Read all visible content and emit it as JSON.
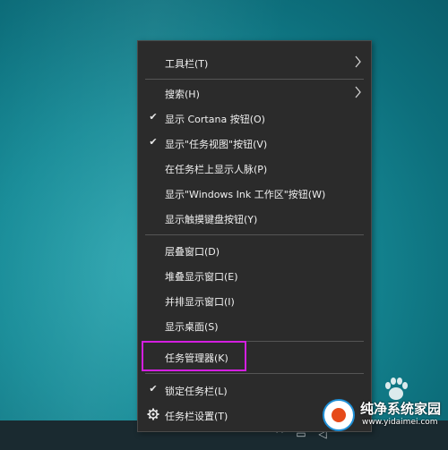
{
  "context_menu": {
    "items": [
      {
        "label": "工具栏(T)",
        "checked": false,
        "submenu": true
      },
      {
        "label": "搜索(H)",
        "checked": false,
        "submenu": true
      },
      {
        "label": "显示 Cortana 按钮(O)",
        "checked": true,
        "submenu": false
      },
      {
        "label": "显示\"任务视图\"按钮(V)",
        "checked": true,
        "submenu": false
      },
      {
        "label": "在任务栏上显示人脉(P)",
        "checked": false,
        "submenu": false
      },
      {
        "label": "显示\"Windows Ink 工作区\"按钮(W)",
        "checked": false,
        "submenu": false
      },
      {
        "label": "显示触摸键盘按钮(Y)",
        "checked": false,
        "submenu": false
      },
      {
        "label": "层叠窗口(D)",
        "checked": false,
        "submenu": false
      },
      {
        "label": "堆叠显示窗口(E)",
        "checked": false,
        "submenu": false
      },
      {
        "label": "并排显示窗口(I)",
        "checked": false,
        "submenu": false
      },
      {
        "label": "显示桌面(S)",
        "checked": false,
        "submenu": false
      },
      {
        "label": "任务管理器(K)",
        "checked": false,
        "submenu": false,
        "highlighted": true
      },
      {
        "label": "锁定任务栏(L)",
        "checked": true,
        "submenu": false
      },
      {
        "label": "任务栏设置(T)",
        "checked": false,
        "submenu": false,
        "icon": "gear-icon"
      }
    ]
  },
  "watermark": {
    "title": "纯净系统家园",
    "url": "www.yidaimei.com"
  },
  "colors": {
    "menu_bg": "#2b2b2b",
    "highlight_border": "#d41fe0",
    "desktop": "#178c98"
  }
}
